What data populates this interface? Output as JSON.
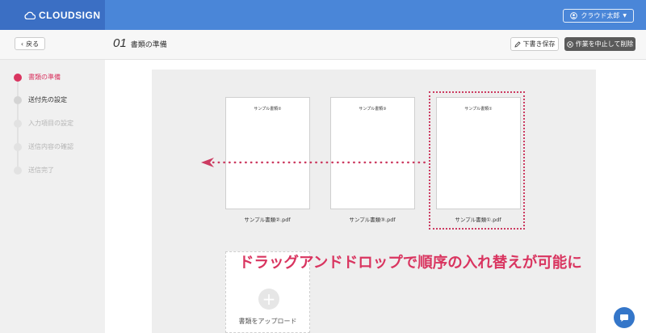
{
  "header": {
    "logo_text": "CLOUDSIGN",
    "user_label": "クラウド太郎"
  },
  "toolbar": {
    "back_label": "戻る",
    "step_number": "01",
    "page_title": "書類の準備",
    "draft_label": "下書き保存",
    "cancel_label": "作業を中止して削除"
  },
  "steps": [
    {
      "label": "書類の準備",
      "state": "active"
    },
    {
      "label": "送付先の設定",
      "state": "next"
    },
    {
      "label": "入力項目の設定",
      "state": "disabled"
    },
    {
      "label": "送信内容の確認",
      "state": "disabled"
    },
    {
      "label": "送信完了",
      "state": "disabled"
    }
  ],
  "documents": [
    {
      "title": "サンプル書類②",
      "filename": "サンプル書類②.pdf"
    },
    {
      "title": "サンプル書類③",
      "filename": "サンプル書類③.pdf"
    },
    {
      "title": "サンプル書類①",
      "filename": "サンプル書類①.pdf"
    }
  ],
  "upload": {
    "label": "書類をアップロード"
  },
  "caption": "ドラッグアンドドロップで順序の入れ替えが可能に",
  "colors": {
    "header": "#4a86d8",
    "logo_bg": "#3b6fc4",
    "accent": "#d93560",
    "cancel_bg": "#5a5a5a",
    "chat": "#3476c9"
  },
  "icons": {
    "logo": "cloud-icon",
    "user": "user-circle-icon",
    "back": "chevron-left-icon",
    "draft": "edit-icon",
    "cancel": "close-circle-icon",
    "upload": "plus-icon",
    "chat": "chat-bubble-icon",
    "arrow": "arrow-left-icon"
  }
}
